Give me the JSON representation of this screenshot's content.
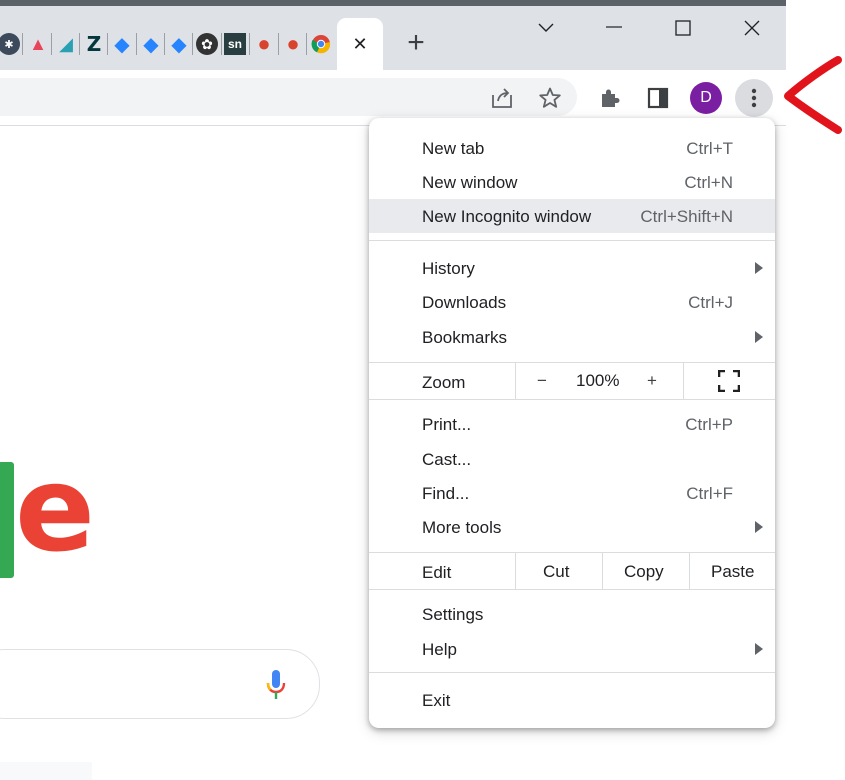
{
  "tabstrip": {
    "favicons": [
      {
        "name": "gear-favicon",
        "color": "#3c4a5b",
        "glyph": "✱"
      },
      {
        "name": "mountain-red-favicon",
        "color": "#e8445a",
        "glyph": "▲"
      },
      {
        "name": "mountain-teal-favicon",
        "color": "#2aa0b3",
        "glyph": "◢"
      },
      {
        "name": "zendesk-favicon",
        "color": "#03363d",
        "glyph": "Z"
      },
      {
        "name": "jira-favicon-1",
        "color": "#2684ff",
        "glyph": "◆"
      },
      {
        "name": "jira-favicon-2",
        "color": "#2684ff",
        "glyph": "◆"
      },
      {
        "name": "jira-favicon-3",
        "color": "#2684ff",
        "glyph": "◆"
      },
      {
        "name": "flower-favicon",
        "color": "#333333",
        "glyph": "✿"
      },
      {
        "name": "servicenow-favicon",
        "color": "#293e40",
        "glyph": "sn"
      },
      {
        "name": "tomato-favicon-1",
        "color": "#d9442f",
        "glyph": "●"
      },
      {
        "name": "tomato-favicon-2",
        "color": "#d9442f",
        "glyph": "●"
      },
      {
        "name": "chrome-favicon",
        "color": "#4285f4",
        "glyph": "◉"
      }
    ],
    "close_tab_glyph": "✕",
    "new_tab_glyph": "+",
    "window": {
      "dropdown_glyph": "⌄",
      "minimize_glyph": "—",
      "maximize_glyph": "☐",
      "close_glyph": "✕"
    }
  },
  "toolbar": {
    "share_glyph": "⇪",
    "star_glyph": "☆",
    "extensions_glyph": "✚",
    "sidepanel_glyph": "◨",
    "profile_initial": "D",
    "menu_glyph": "⋮",
    "profile_color": "#7b1fa2"
  },
  "page": {
    "logo_partial": "e",
    "colors": {
      "green": "#34a853",
      "red": "#ea4335"
    }
  },
  "menu": {
    "group1": [
      {
        "label": "New tab",
        "shortcut": "Ctrl+T"
      },
      {
        "label": "New window",
        "shortcut": "Ctrl+N"
      },
      {
        "label": "New Incognito window",
        "shortcut": "Ctrl+Shift+N"
      }
    ],
    "group2": [
      {
        "label": "History",
        "shortcut": ""
      },
      {
        "label": "Downloads",
        "shortcut": "Ctrl+J"
      },
      {
        "label": "Bookmarks",
        "shortcut": ""
      }
    ],
    "zoom": {
      "label": "Zoom",
      "minus": "−",
      "value": "100%",
      "plus": "+"
    },
    "group3": [
      {
        "label": "Print...",
        "shortcut": "Ctrl+P"
      },
      {
        "label": "Cast...",
        "shortcut": ""
      },
      {
        "label": "Find...",
        "shortcut": "Ctrl+F"
      },
      {
        "label": "More tools",
        "shortcut": ""
      }
    ],
    "edit": {
      "label": "Edit",
      "cut": "Cut",
      "copy": "Copy",
      "paste": "Paste"
    },
    "group4": [
      {
        "label": "Settings"
      },
      {
        "label": "Help"
      }
    ],
    "exit": {
      "label": "Exit"
    }
  },
  "annotation": {
    "color": "#e2141b"
  }
}
